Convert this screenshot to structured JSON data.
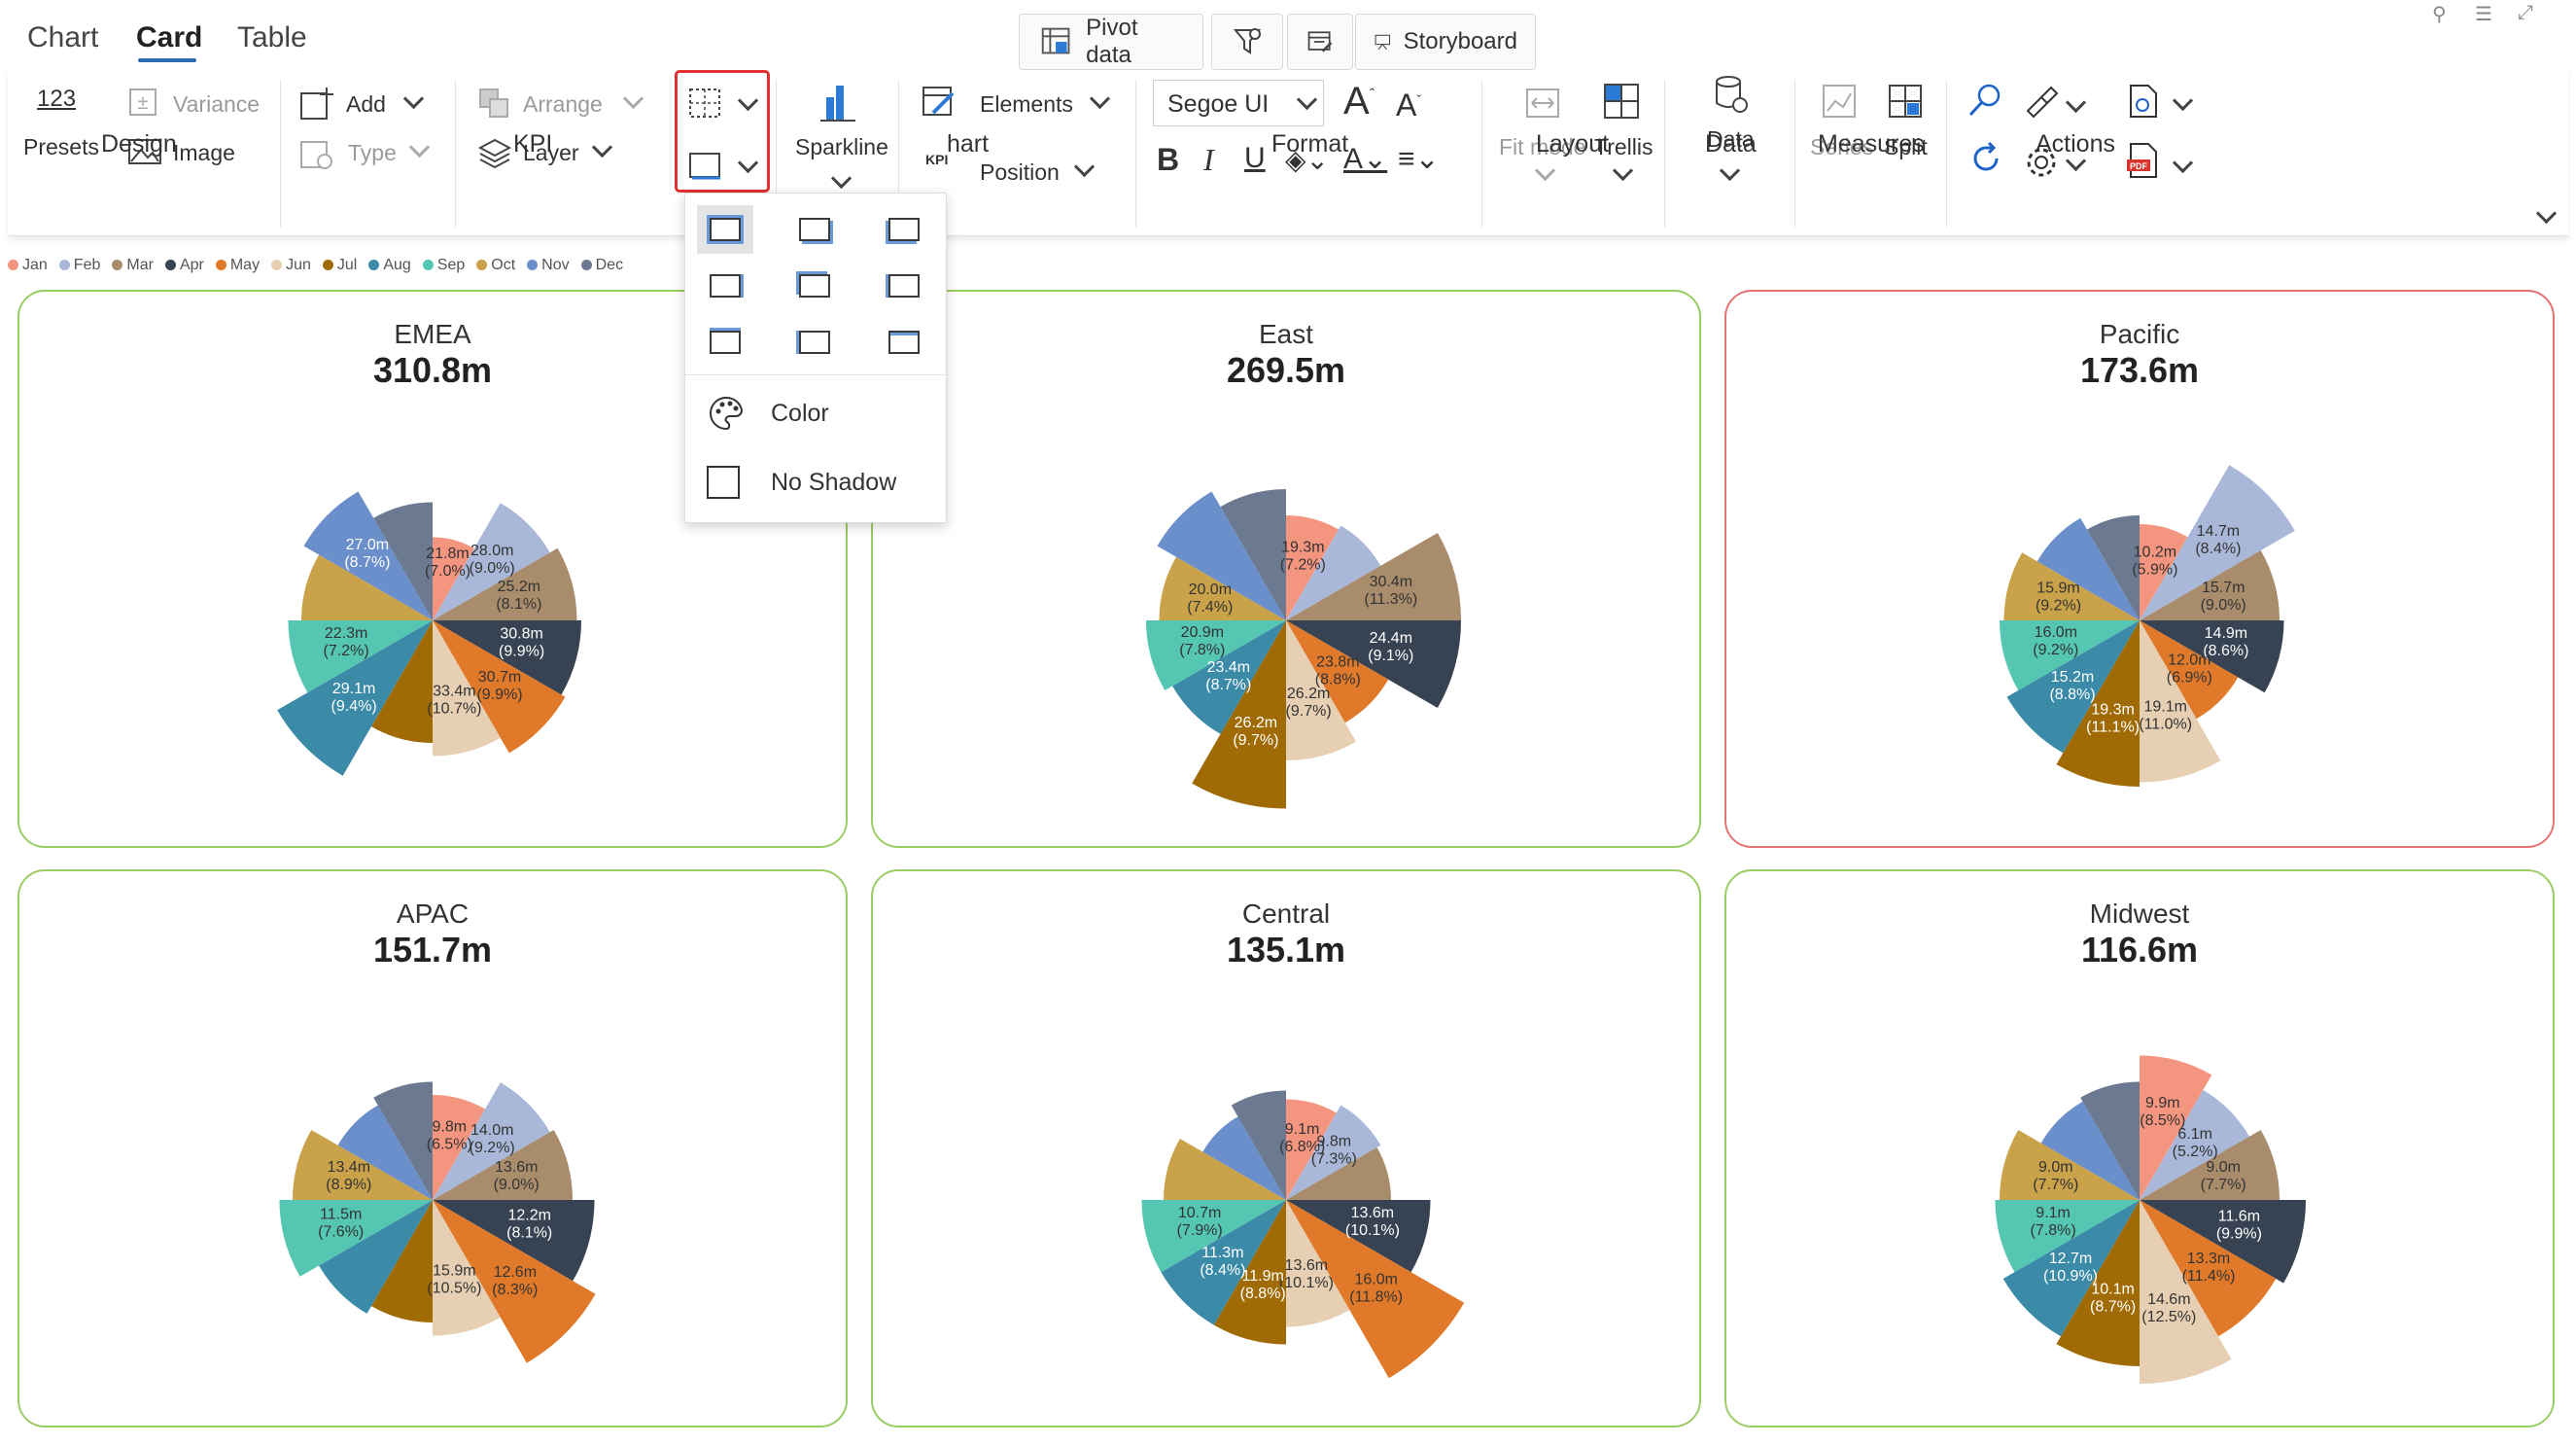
{
  "nav": {
    "tabs": [
      "Chart",
      "Card",
      "Table"
    ],
    "active_tab": "Card"
  },
  "top_tools": {
    "pivot_data": "Pivot data",
    "storyboard": "Storyboard"
  },
  "ribbon": {
    "design": {
      "presets_num": "123",
      "presets": "Presets",
      "variance": "Variance",
      "image": "Image",
      "group": "Design"
    },
    "kpi": {
      "add": "Add",
      "type": "Type",
      "arrange": "Arrange",
      "layer": "Layer",
      "group": "KPI"
    },
    "chart": {
      "sparkline": "Sparkline",
      "kpi_badge": "KPI",
      "elements": "Elements",
      "position": "Position",
      "group": "Chart",
      "group_visible": "hart"
    },
    "format": {
      "font": "Segoe UI",
      "group": "Format"
    },
    "layout": {
      "fit_mode": "Fit mode",
      "trellis": "Trellis",
      "group": "Layout"
    },
    "data": {
      "data": "Data",
      "group": "Data"
    },
    "measures": {
      "series": "Series",
      "split": "Split",
      "group": "Measures"
    },
    "actions": {
      "group": "Actions"
    }
  },
  "legend": [
    {
      "label": "Jan",
      "color": "#F4957F"
    },
    {
      "label": "Feb",
      "color": "#A9B8D8"
    },
    {
      "label": "Mar",
      "color": "#A88C6C"
    },
    {
      "label": "Apr",
      "color": "#374252"
    },
    {
      "label": "May",
      "color": "#E07A2A"
    },
    {
      "label": "Jun",
      "color": "#E6CFB2"
    },
    {
      "label": "Jul",
      "color": "#A06A05"
    },
    {
      "label": "Aug",
      "color": "#3A8AA8"
    },
    {
      "label": "Sep",
      "color": "#55C6B2"
    },
    {
      "label": "Oct",
      "color": "#C9A24A"
    },
    {
      "label": "Nov",
      "color": "#6A8FCB"
    },
    {
      "label": "Dec",
      "color": "#6B7A91"
    }
  ],
  "dropdown": {
    "color": "Color",
    "no_shadow": "No Shadow"
  },
  "cards": [
    {
      "title": "EMEA",
      "value": "310.8m",
      "border": "green",
      "labels": [
        "21.8m\n(7.0%)",
        "28.0m\n(9.0%)",
        "25.2m\n(8.1%)",
        "30.8m\n(9.9%)",
        "30.7m\n(9.9%)",
        "33.4m\n(10.7%)",
        "",
        "29.1m\n(9.4%)",
        "22.3m\n(7.2%)",
        "",
        "27.0m\n(8.7%)",
        ""
      ],
      "radii": [
        0.38,
        0.62,
        0.66,
        0.68,
        0.7,
        0.62,
        0.56,
        0.82,
        0.66,
        0.6,
        0.68,
        0.54
      ]
    },
    {
      "title": "East",
      "value": "269.5m",
      "border": "green",
      "labels": [
        "19.3m\n(7.2%)",
        "",
        "30.4m\n(11.3%)",
        "24.4m\n(9.1%)",
        "23.8m\n(8.8%)",
        "26.2m\n(9.7%)",
        "26.2m\n(9.7%)",
        "23.4m\n(8.7%)",
        "20.9m\n(7.8%)",
        "20.0m\n(7.4%)",
        "",
        ""
      ],
      "radii": [
        0.48,
        0.5,
        0.8,
        0.8,
        0.54,
        0.64,
        0.86,
        0.6,
        0.64,
        0.58,
        0.68,
        0.6
      ]
    },
    {
      "title": "Pacific",
      "value": "173.6m",
      "border": "red",
      "labels": [
        "10.2m\n(5.9%)",
        "14.7m\n(8.4%)",
        "15.7m\n(9.0%)",
        "14.9m\n(8.6%)",
        "12.0m\n(6.9%)",
        "19.1m\n(11.0%)",
        "19.3m\n(11.1%)",
        "15.2m\n(8.8%)",
        "16.0m\n(9.2%)",
        "15.9m\n(9.2%)",
        "",
        ""
      ],
      "radii": [
        0.44,
        0.82,
        0.64,
        0.66,
        0.52,
        0.74,
        0.76,
        0.7,
        0.64,
        0.62,
        0.54,
        0.48
      ]
    },
    {
      "title": "APAC",
      "value": "151.7m",
      "border": "green",
      "labels": [
        "9.8m\n(6.5%)",
        "14.0m\n(9.2%)",
        "13.6m\n(9.0%)",
        "12.2m\n(8.1%)",
        "12.6m\n(8.3%)",
        "15.9m\n(10.5%)",
        "",
        "",
        "11.5m\n(7.6%)",
        "13.4m\n(8.9%)",
        "",
        ""
      ],
      "radii": [
        0.48,
        0.62,
        0.64,
        0.74,
        0.86,
        0.62,
        0.56,
        0.6,
        0.7,
        0.64,
        0.5,
        0.54
      ]
    },
    {
      "title": "Central",
      "value": "135.1m",
      "border": "green",
      "labels": [
        "9.1m\n(6.8%)",
        "9.8m\n(7.3%)",
        "",
        "13.6m\n(10.1%)",
        "16.0m\n(11.8%)",
        "13.6m\n(10.1%)",
        "11.9m\n(8.8%)",
        "11.3m\n(8.4%)",
        "10.7m\n(7.9%)",
        "",
        "",
        ""
      ],
      "radii": [
        0.46,
        0.5,
        0.48,
        0.66,
        0.94,
        0.58,
        0.66,
        0.66,
        0.66,
        0.56,
        0.44,
        0.5
      ]
    },
    {
      "title": "Midwest",
      "value": "116.6m",
      "border": "green",
      "labels": [
        "9.9m\n(8.5%)",
        "6.1m\n(5.2%)",
        "9.0m\n(7.7%)",
        "11.6m\n(9.9%)",
        "13.3m\n(11.4%)",
        "14.6m\n(12.5%)",
        "10.1m\n(8.7%)",
        "12.7m\n(10.9%)",
        "9.1m\n(7.8%)",
        "9.0m\n(7.7%)",
        "",
        ""
      ],
      "radii": [
        0.66,
        0.58,
        0.64,
        0.76,
        0.72,
        0.84,
        0.76,
        0.72,
        0.66,
        0.64,
        0.52,
        0.54
      ]
    }
  ]
}
